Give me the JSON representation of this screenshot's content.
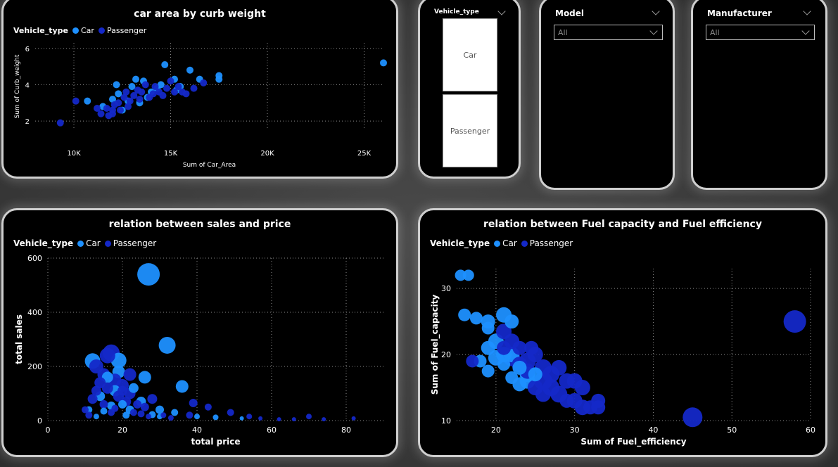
{
  "colors": {
    "car": "#1e90ff",
    "passenger": "#1428c8",
    "grid": "#8a8a8a"
  },
  "slicers": {
    "vehicle_type": {
      "label": "Vehicle_type",
      "tiles": [
        "Car",
        "Passenger"
      ]
    },
    "model": {
      "label": "Model",
      "value": "All"
    },
    "manufacturer": {
      "label": "Manufacturer",
      "value": "All"
    }
  },
  "legend": {
    "title": "Vehicle_type",
    "car": "Car",
    "passenger": "Passenger"
  },
  "chart_data": [
    {
      "type": "scatter",
      "title": "car area by curb weight",
      "xlabel": "Sum of Car_Area",
      "ylabel": "Sum of Curb_weight",
      "xlim": [
        8000,
        26000
      ],
      "ylim": [
        1.5,
        6.3
      ],
      "xticks": [
        10000,
        15000,
        20000,
        25000
      ],
      "xticklabels": [
        "10K",
        "15K",
        "20K",
        "25K"
      ],
      "yticks": [
        2,
        4,
        6
      ],
      "yticklabels": [
        "2",
        "4",
        "6"
      ],
      "legend_position": "top-left",
      "grid": true,
      "series": [
        {
          "name": "Car",
          "points": [
            [
              10700,
              3.1
            ],
            [
              12000,
              3.2
            ],
            [
              12300,
              3.5
            ],
            [
              13000,
              3.9
            ],
            [
              13200,
              4.3
            ],
            [
              13800,
              3.3
            ],
            [
              14300,
              3.8
            ],
            [
              14500,
              4.0
            ],
            [
              14700,
              5.1
            ],
            [
              15200,
              4.3
            ],
            [
              15500,
              3.9
            ],
            [
              16000,
              4.8
            ],
            [
              16500,
              4.3
            ],
            [
              17500,
              4.5
            ],
            [
              17500,
              4.3
            ],
            [
              26000,
              5.2
            ],
            [
              11500,
              2.8
            ],
            [
              12800,
              3.1
            ],
            [
              13400,
              3.0
            ],
            [
              12500,
              2.6
            ],
            [
              14000,
              3.6
            ],
            [
              15300,
              3.7
            ],
            [
              12200,
              4.0
            ],
            [
              13600,
              4.2
            ]
          ]
        },
        {
          "name": "Passenger",
          "points": [
            [
              9300,
              1.9
            ],
            [
              10100,
              3.1
            ],
            [
              11200,
              2.7
            ],
            [
              11400,
              2.4
            ],
            [
              11700,
              2.7
            ],
            [
              12000,
              2.4
            ],
            [
              12100,
              2.9
            ],
            [
              12300,
              3.0
            ],
            [
              12400,
              2.6
            ],
            [
              12600,
              3.3
            ],
            [
              12700,
              3.6
            ],
            [
              12900,
              3.1
            ],
            [
              13100,
              3.4
            ],
            [
              13300,
              3.7
            ],
            [
              13400,
              3.2
            ],
            [
              13500,
              3.6
            ],
            [
              13700,
              4.0
            ],
            [
              13900,
              3.3
            ],
            [
              14100,
              3.5
            ],
            [
              14200,
              3.9
            ],
            [
              14400,
              3.6
            ],
            [
              14600,
              3.4
            ],
            [
              14800,
              3.8
            ],
            [
              15000,
              4.2
            ],
            [
              15200,
              3.6
            ],
            [
              15400,
              3.9
            ],
            [
              15600,
              3.6
            ],
            [
              15800,
              3.5
            ],
            [
              16200,
              3.8
            ],
            [
              16700,
              4.1
            ],
            [
              11800,
              2.3
            ],
            [
              12000,
              2.6
            ],
            [
              12800,
              2.8
            ]
          ]
        }
      ]
    },
    {
      "type": "scatter",
      "title": "relation between sales and price",
      "xlabel": "total price",
      "ylabel": "total sales",
      "xlim": [
        0,
        90
      ],
      "ylim": [
        0,
        600
      ],
      "xticks": [
        0,
        20,
        40,
        60,
        80
      ],
      "xticklabels": [
        "0",
        "20",
        "40",
        "60",
        "80"
      ],
      "yticks": [
        0,
        200,
        400,
        600
      ],
      "yticklabels": [
        "0",
        "200",
        "400",
        "600"
      ],
      "legend_position": "top-left",
      "grid": true,
      "series": [
        {
          "name": "Car",
          "points": [
            [
              27,
              540,
              16
            ],
            [
              32,
              278,
              12
            ],
            [
              36,
              126,
              9
            ],
            [
              26,
              160,
              9
            ],
            [
              19,
              222,
              11
            ],
            [
              12,
              220,
              11
            ],
            [
              19,
              180,
              9
            ],
            [
              18,
              110,
              8
            ],
            [
              25,
              70,
              7
            ],
            [
              17,
              55,
              6
            ],
            [
              22,
              40,
              6
            ],
            [
              30,
              40,
              6
            ],
            [
              34,
              30,
              5
            ],
            [
              28,
              22,
              5
            ],
            [
              15,
              35,
              5
            ],
            [
              13,
              15,
              4
            ],
            [
              21,
              20,
              5
            ],
            [
              40,
              15,
              4
            ],
            [
              45,
              12,
              4
            ],
            [
              52,
              8,
              3
            ],
            [
              16,
              160,
              8
            ],
            [
              23,
              120,
              7
            ],
            [
              30,
              15,
              4
            ],
            [
              11,
              40,
              5
            ],
            [
              20,
              60,
              6
            ],
            [
              14,
              90,
              7
            ]
          ]
        },
        {
          "name": "Passenger",
          "points": [
            [
              17,
              250,
              12
            ],
            [
              13,
              200,
              10
            ],
            [
              15,
              170,
              9
            ],
            [
              18,
              150,
              9
            ],
            [
              20,
              130,
              9
            ],
            [
              22,
              100,
              8
            ],
            [
              14,
              140,
              8
            ],
            [
              16,
              120,
              8
            ],
            [
              12,
              80,
              7
            ],
            [
              19,
              90,
              8
            ],
            [
              21,
              70,
              7
            ],
            [
              24,
              60,
              6
            ],
            [
              26,
              50,
              6
            ],
            [
              28,
              80,
              7
            ],
            [
              10,
              40,
              5
            ],
            [
              11,
              20,
              5
            ],
            [
              15,
              60,
              6
            ],
            [
              17,
              30,
              5
            ],
            [
              18,
              45,
              5
            ],
            [
              23,
              30,
              5
            ],
            [
              25,
              25,
              5
            ],
            [
              27,
              15,
              4
            ],
            [
              31,
              20,
              4
            ],
            [
              33,
              10,
              4
            ],
            [
              38,
              20,
              5
            ],
            [
              39,
              65,
              6
            ],
            [
              43,
              50,
              5
            ],
            [
              49,
              30,
              5
            ],
            [
              54,
              15,
              4
            ],
            [
              57,
              8,
              3
            ],
            [
              62,
              5,
              3
            ],
            [
              66,
              5,
              3
            ],
            [
              70,
              15,
              4
            ],
            [
              74,
              5,
              3
            ],
            [
              82,
              8,
              3
            ],
            [
              20,
              110,
              7
            ],
            [
              13,
              110,
              7
            ],
            [
              22,
              170,
              9
            ],
            [
              16,
              240,
              11
            ]
          ]
        }
      ]
    },
    {
      "type": "scatter",
      "title": "relation between Fuel capacity and Fuel efficiency",
      "xlabel": "Sum of Fuel_efficiency",
      "ylabel": "Sum of Fuel_capacity",
      "xlim": [
        15,
        60
      ],
      "ylim": [
        10,
        33
      ],
      "xticks": [
        20,
        30,
        40,
        50,
        60
      ],
      "xticklabels": [
        "20",
        "30",
        "40",
        "50",
        "60"
      ],
      "yticks": [
        10,
        20,
        30
      ],
      "yticklabels": [
        "10",
        "20",
        "30"
      ],
      "legend_position": "top-left",
      "grid": true,
      "series": [
        {
          "name": "Car",
          "points": [
            [
              15.5,
              32,
              8
            ],
            [
              16.5,
              32,
              8
            ],
            [
              16,
              26,
              9
            ],
            [
              17.5,
              25.5,
              9
            ],
            [
              19,
              25,
              10
            ],
            [
              19,
              24,
              9
            ],
            [
              21,
              26,
              11
            ],
            [
              22,
              25,
              10
            ],
            [
              19,
              21,
              10
            ],
            [
              20,
              22,
              11
            ],
            [
              21,
              20,
              11
            ],
            [
              19,
              17.5,
              9
            ],
            [
              20,
              19.5,
              11
            ],
            [
              22,
              20,
              11
            ],
            [
              23,
              18,
              10
            ],
            [
              24,
              17,
              11
            ],
            [
              23,
              15.5,
              10
            ],
            [
              24,
              16,
              11
            ],
            [
              25,
              17,
              10
            ],
            [
              18,
              19,
              9
            ],
            [
              21,
              18.5,
              9
            ],
            [
              22,
              16.5,
              9
            ]
          ]
        },
        {
          "name": "Passenger",
          "points": [
            [
              21,
              23.5,
              11
            ],
            [
              22,
              22,
              11
            ],
            [
              21,
              21,
              10
            ],
            [
              22,
              19.5,
              12
            ],
            [
              23,
              18.5,
              11
            ],
            [
              24,
              19,
              12
            ],
            [
              25,
              20,
              11
            ],
            [
              26,
              18,
              12
            ],
            [
              27,
              17,
              12
            ],
            [
              26,
              16,
              13
            ],
            [
              27,
              15,
              12
            ],
            [
              28,
              14,
              12
            ],
            [
              29,
              16,
              11
            ],
            [
              28,
              18,
              11
            ],
            [
              30,
              16,
              11
            ],
            [
              31,
              15,
              11
            ],
            [
              30,
              13,
              11
            ],
            [
              31,
              12,
              11
            ],
            [
              32,
              12,
              10
            ],
            [
              33,
              13,
              10
            ],
            [
              33,
              12,
              10
            ],
            [
              29,
              13,
              10
            ],
            [
              26,
              14,
              11
            ],
            [
              25,
              15,
              11
            ],
            [
              24,
              17.5,
              11
            ],
            [
              23,
              21,
              10
            ],
            [
              24.5,
              21,
              10
            ],
            [
              17,
              19,
              9
            ],
            [
              58,
              25,
              16
            ],
            [
              45,
              10.5,
              14
            ]
          ]
        }
      ]
    }
  ]
}
